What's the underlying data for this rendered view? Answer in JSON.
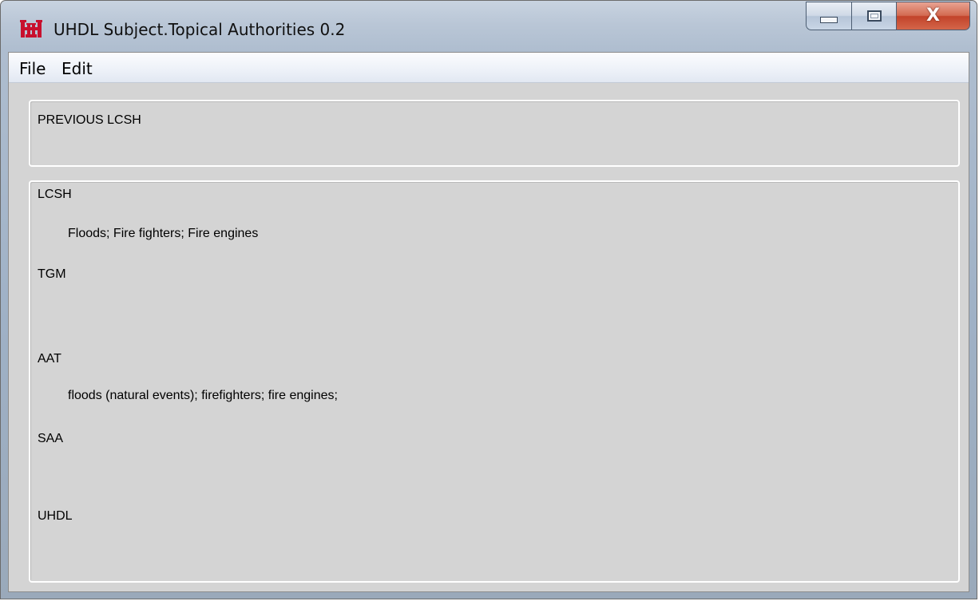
{
  "window": {
    "title": "UHDL Subject.Topical Authorities 0.2",
    "caption_buttons": [
      "minimize-icon",
      "maximize-icon",
      "close-icon"
    ],
    "close_glyph": "X"
  },
  "menubar": {
    "items": [
      "File",
      "Edit"
    ]
  },
  "previous_panel": {
    "label": "PREVIOUS LCSH"
  },
  "authorities": {
    "lcsh_label": "LCSH",
    "lcsh_value": "Floods; Fire fighters; Fire engines",
    "tgm_label": "TGM",
    "tgm_value": "",
    "aat_label": "AAT",
    "aat_value": "floods (natural events); firefighters; fire engines;",
    "saa_label": "SAA",
    "saa_value": "",
    "uhdl_label": "UHDL",
    "uhdl_value": ""
  },
  "colors": {
    "logo": "#c8102e",
    "close_button": "#c2432a",
    "client_background": "#d4d4d4"
  }
}
